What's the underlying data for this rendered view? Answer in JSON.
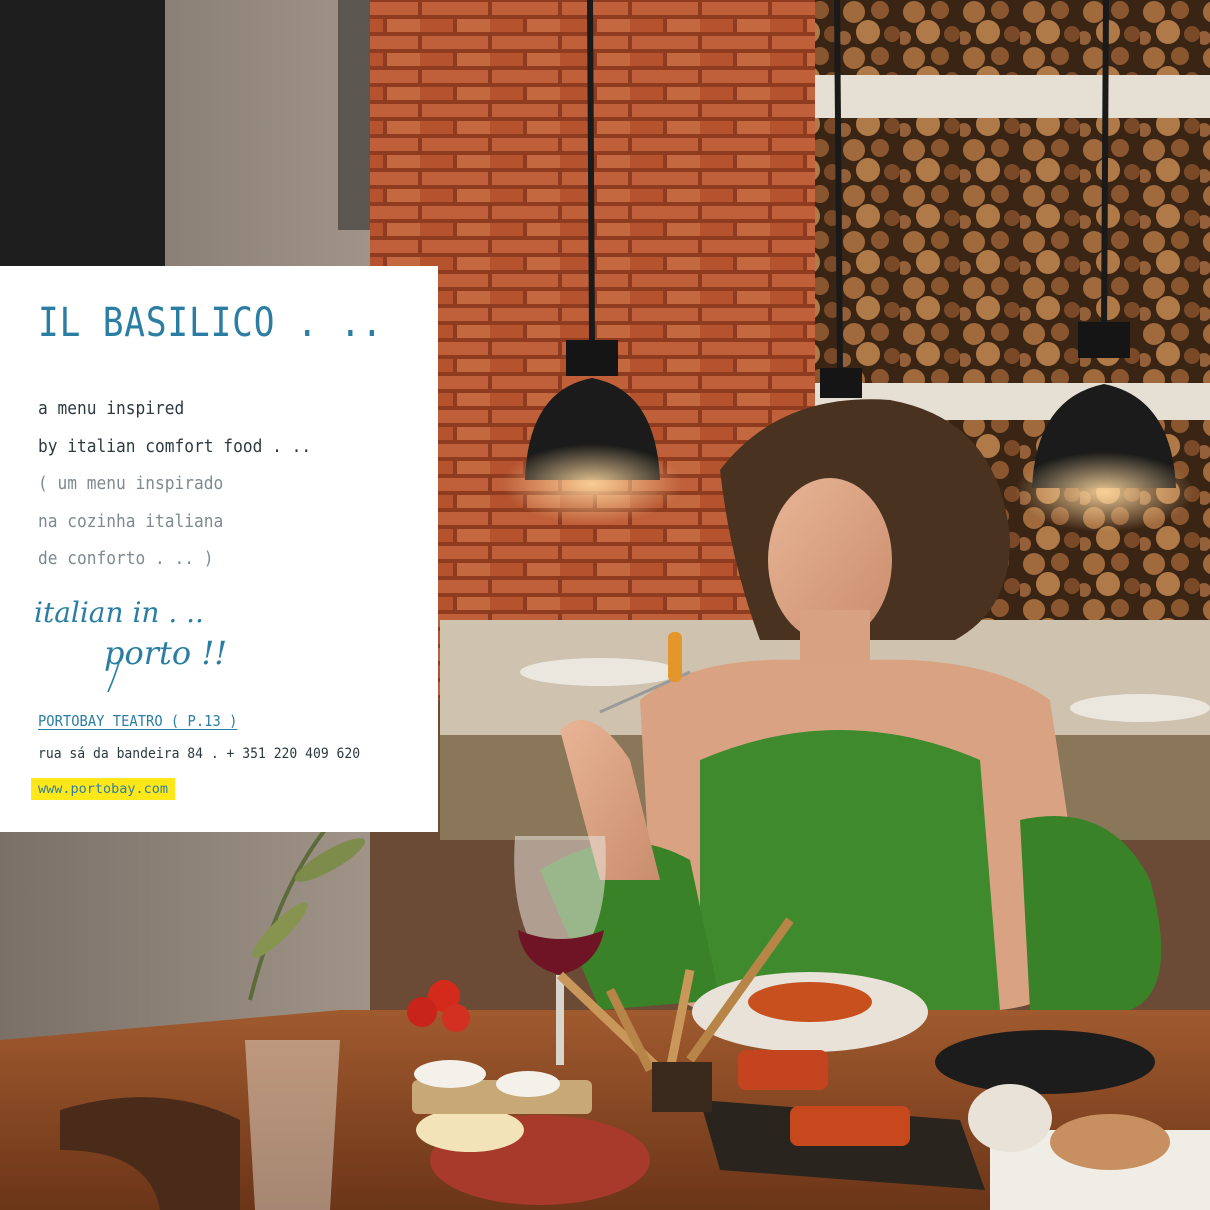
{
  "card": {
    "title": "IL BASILICO . ..",
    "description_en": [
      "a menu inspired",
      "by italian comfort food . .."
    ],
    "description_pt": [
      "( um menu inspirado",
      "na cozinha italiana",
      "de conforto . .. )"
    ],
    "script_line1": "italian in . ..",
    "script_line2": "porto !!",
    "hotel_reference": "PORTOBAY TEATRO ( P.13 )",
    "address": "rua sá da bandeira 84 . + 351 220 409 620",
    "website": "www.portobay.com"
  },
  "colors": {
    "accent_blue": "#2a7ea3",
    "highlight_yellow": "#ffe81a",
    "dress_green": "#3e8a2c",
    "brick": "#b5532c"
  },
  "photo": {
    "subjects": [
      "brick-wall",
      "firewood-stack",
      "pendant-lamps",
      "woman-in-green-dress",
      "pasta-dish",
      "red-wine-glass",
      "bruschetta",
      "breadsticks",
      "cheese-board"
    ]
  }
}
